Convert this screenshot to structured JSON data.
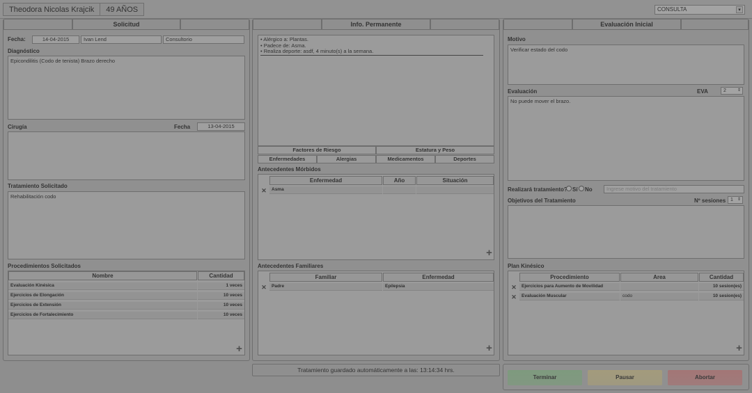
{
  "header": {
    "patient_name": "Theodora Nicolas Krajcik",
    "age": "49 AÑOS",
    "mode_select": "CONSULTA"
  },
  "solicitud": {
    "tab_label": "Solicitud",
    "fecha_label": "Fecha:",
    "fecha_value": "14-04-2015",
    "doctor": "Ivan Lend",
    "lugar": "Consultorio",
    "diagnostico_label": "Diagnóstico",
    "diagnostico_value": "Epicondilitis (Codo de tenista) Brazo derecho",
    "cirugia_label": "Cirugía",
    "cirugia_fecha_label": "Fecha",
    "cirugia_fecha_value": "13-04-2015",
    "tratamiento_label": "Tratamiento Solicitado",
    "tratamiento_value": "Rehabilitación codo",
    "procedimientos_label": "Procedimientos Solicitados",
    "proc_columns": [
      "Nombre",
      "Cantidad"
    ],
    "procedimientos": [
      {
        "nombre": "Evaluación Kinésica",
        "cantidad": "1 veces"
      },
      {
        "nombre": "Ejercicios de Elongación",
        "cantidad": "10 veces"
      },
      {
        "nombre": "Ejercicios de Extensión",
        "cantidad": "10 veces"
      },
      {
        "nombre": "Ejercicios de Fortalecimiento",
        "cantidad": "10 veces"
      }
    ]
  },
  "info": {
    "tab_label": "Info. Permanente",
    "lines": [
      "• Alérgico a: Plantas.",
      "• Padece de: Asma.",
      "• Realiza deporte: asdf, 4 minuto(s) a la semana."
    ],
    "tabs_row1": [
      "Factores de Riesgo",
      "Estatura y Peso"
    ],
    "tabs_row2": [
      "Enfermedades",
      "Alergias",
      "Medicamentos",
      "Deportes"
    ],
    "morbidos_label": "Antecedentes Mórbidos",
    "morbidos_columns": [
      "Enfermedad",
      "Año",
      "Situación"
    ],
    "morbidos_rows": [
      {
        "enfermedad": "Asma",
        "anio": "",
        "situacion": ""
      }
    ],
    "familiares_label": "Antecedentes Familiares",
    "familiares_columns": [
      "Familiar",
      "Enfermedad"
    ],
    "familiares_rows": [
      {
        "familiar": "Padre",
        "enfermedad": "Epilepsia"
      }
    ]
  },
  "evaluacion": {
    "tab_label": "Evaluación Inicial",
    "motivo_label": "Motivo",
    "motivo_value": "Verificar estado del codo",
    "evaluacion_label": "Evaluación",
    "eva_label": "EVA",
    "eva_value": "2",
    "evaluacion_value": "No puede mover el brazo.",
    "realizara_label": "Realizará tratamiento?",
    "si_label": "Sí",
    "no_label": "No",
    "motivo_placeholder": "Ingrese motivo del tratamiento",
    "objetivos_label": "Objetivos del Tratamiento",
    "sesiones_label": "Nº sesiones",
    "sesiones_value": "1",
    "plan_label": "Plan Kinésico",
    "plan_columns": [
      "Procedimiento",
      "Area",
      "Cantidad"
    ],
    "plan_rows": [
      {
        "procedimiento": "Ejercicios para Aumento de Movilidad",
        "area": "",
        "cantidad": "10 sesion(es)"
      },
      {
        "procedimiento": "Evaluación Muscular",
        "area": "codo",
        "cantidad": "10 sesion(es)"
      }
    ]
  },
  "status": {
    "autosave": "Tratamiento guardado automáticamente a las: 13:14:34 hrs."
  },
  "actions": {
    "terminar": "Terminar",
    "pausar": "Pausar",
    "abortar": "Abortar"
  },
  "colors": {
    "terminar_bg": "#7e9a7e",
    "pausar_bg": "#a39b7c",
    "abortar_bg": "#a37676"
  }
}
